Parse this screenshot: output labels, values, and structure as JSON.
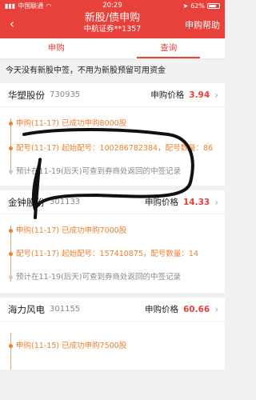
{
  "status": {
    "carrier": "中国联通",
    "time": "20:29",
    "battery": "62%"
  },
  "header": {
    "title": "新股/债申购",
    "subtitle": "中航证券**1357",
    "help": "申购帮助"
  },
  "tabs": [
    {
      "label": "申购"
    },
    {
      "label": "查询"
    }
  ],
  "notice": "今天没有新股中签，不用为新股预留可用资金",
  "stocks": [
    {
      "name": "华塑股份",
      "code": "730935",
      "price_label": "申购价格",
      "price": "3.94",
      "ev1": "申购(11-17) 已成功申购8000股",
      "ev2": "配号(11-17) 起始配号：100286782384，配号数量：86",
      "ev3": "预计在11-19(后天)可查到券商处返回的中签记录"
    },
    {
      "name": "金钟股份",
      "code": "301133",
      "price_label": "申购价格",
      "price": "14.33",
      "ev1": "申购(11-17) 已成功申购7000股",
      "ev2": "配号(11-17) 起始配号：157410875，配号数量：14",
      "ev3": "预计在11-19(后天)可查到券商处返回的中签记录"
    },
    {
      "name": "海力风电",
      "code": "301155",
      "price_label": "申购价格",
      "price": "60.66",
      "ev1": "申购(11-15) 已成功申购7500股"
    }
  ]
}
